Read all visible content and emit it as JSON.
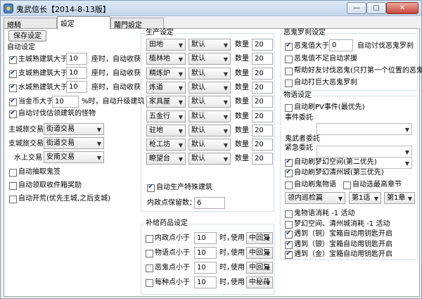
{
  "window": {
    "title": "鬼武信长【2014-8-13版】",
    "minimize": "—",
    "maximize": "□",
    "close": "✕"
  },
  "tabs": [
    "總騎",
    "設定",
    "鬮門設定"
  ],
  "left": {
    "save_button": "保存设定",
    "auto_setting_title": "自动设定",
    "build_rows": [
      {
        "checked": true,
        "label": "主城熟建筑大于",
        "value": "10",
        "suffix": "座时，自动收获"
      },
      {
        "checked": true,
        "label": "支城熟建筑大于",
        "value": "10",
        "suffix": "座时，自动收获"
      },
      {
        "checked": true,
        "label": "水城熟建筑大于",
        "value": "10",
        "suffix": "座时，自动收获"
      }
    ],
    "gold_row": {
      "checked": true,
      "label": "当金币大于",
      "value": "10",
      "suffix": "%时，自动升级建筑"
    },
    "auto_estimate": {
      "checked": true,
      "label": "自动讨伐估领建筑的怪物"
    },
    "trade_rows": [
      {
        "label": "主城旅交易",
        "value": "街道交易"
      },
      {
        "label": "支城旅交易",
        "value": "街道交易"
      },
      {
        "label": "水上交易",
        "value": "安南交易"
      }
    ],
    "bottom_checks": [
      {
        "checked": false,
        "label": "自动抽取鬼签"
      },
      {
        "checked": false,
        "label": "自动领取收件箱奖励"
      },
      {
        "checked": false,
        "label": "自动开荒(优先主城,之后支城)"
      }
    ]
  },
  "production": {
    "title": "生产设定",
    "qty_label": "数量",
    "rows": [
      {
        "building": "田地",
        "mode": "默认",
        "qty": "20"
      },
      {
        "building": "植林地",
        "mode": "默认",
        "qty": "20"
      },
      {
        "building": "精炼炉",
        "mode": "默认",
        "qty": "20"
      },
      {
        "building": "炼道",
        "mode": "默认",
        "qty": "20"
      },
      {
        "building": "家具屋",
        "mode": "默认",
        "qty": "20"
      },
      {
        "building": "五金行",
        "mode": "默认",
        "qty": "20"
      },
      {
        "building": "驻地",
        "mode": "默认",
        "qty": "20"
      },
      {
        "building": "枪工坊",
        "mode": "默认",
        "qty": "20"
      },
      {
        "building": "瞭望台",
        "mode": "默认",
        "qty": "20"
      }
    ],
    "special": {
      "checked": true,
      "label": "自动生产特殊建筑"
    },
    "reserve_label": "内政点保留数：",
    "reserve_value": "6"
  },
  "supply": {
    "title": "补给药品设定",
    "use_label": "使用",
    "unit": "时，",
    "rows": [
      {
        "checked": false,
        "label": "内政点小于",
        "value": "10",
        "drug": "中回复"
      },
      {
        "checked": false,
        "label": "物语点小于",
        "value": "10",
        "drug": "中回复"
      },
      {
        "checked": false,
        "label": "恶鬼点小于",
        "value": "10",
        "drug": "中回复"
      },
      {
        "checked": false,
        "label": "每种点小于",
        "value": "10",
        "drug": "中秘药"
      }
    ]
  },
  "evil": {
    "title": "恶鬼罗刹设定",
    "value_row": {
      "checked": true,
      "label": "恶鬼值大于",
      "value": "0",
      "suffix": "自动讨伐恶鬼罗刹"
    },
    "checks": [
      {
        "checked": false,
        "label": "恶鬼值不足自动求援"
      },
      {
        "checked": false,
        "label": "帮助好友讨伐恶鬼(只打第一个位置的恶鬼)"
      },
      {
        "checked": false,
        "label": "自动打巨大恶鬼罗刹"
      }
    ]
  },
  "story": {
    "title": "物语设定",
    "pv": {
      "checked": false,
      "label": "自动刷PV事件(最优先)"
    },
    "event_label": "事件委託",
    "ghost_label": "鬼武者委託",
    "urgent_label": "紧急委託",
    "dream": {
      "checked": true,
      "label": "自动刷梦幻空间(第二优先)"
    },
    "dream2": {
      "checked": true,
      "label": "自动刷梦幻清州城(第三优先)"
    },
    "ghost_story": {
      "checked": false,
      "label": "自动刷鬼物语"
    },
    "latest": {
      "checked": false,
      "label": "自动选最高章节"
    },
    "chapter_select": "领内巡检篇",
    "talk_select": "第1话",
    "chapter_no": "第1章",
    "lower_checks": [
      {
        "checked": false,
        "label": "鬼物语消耗 -1 活动"
      },
      {
        "checked": false,
        "label": "梦幻空间、清州城消耗 -1 活动"
      },
      {
        "checked": true,
        "label": "遇到（铜）宝箱自动用钥匙开启"
      },
      {
        "checked": true,
        "label": "遇到（银）宝箱自动用钥匙开启"
      },
      {
        "checked": true,
        "label": "遇到（金）宝箱自动用钥匙开启"
      }
    ]
  }
}
